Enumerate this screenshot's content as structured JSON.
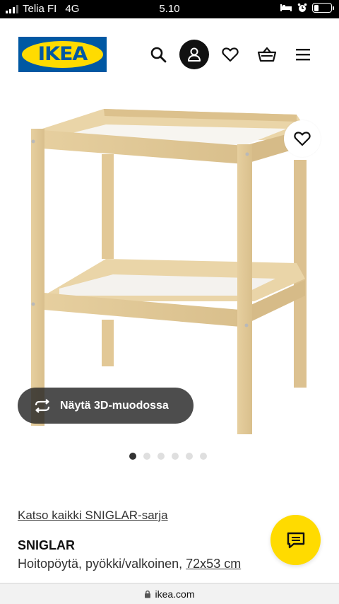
{
  "status_bar": {
    "carrier": "Telia FI",
    "network": "4G",
    "time": "5.10",
    "icons": [
      "signal-icon",
      "bed-icon",
      "alarm-icon",
      "battery-icon"
    ],
    "battery_level": 0.3
  },
  "header": {
    "logo_text": "IKEA",
    "brand_colors": {
      "blue": "#0058a3",
      "yellow": "#ffdb00"
    },
    "icons": [
      "search-icon",
      "account-icon",
      "heart-icon",
      "basket-icon",
      "menu-icon"
    ]
  },
  "gallery": {
    "view_3d_label": "Näytä 3D-muodossa",
    "image_count": 6,
    "active_index": 0
  },
  "product": {
    "series_link": "Katso kaikki SNIGLAR-sarja",
    "name": "SNIGLAR",
    "description": "Hoitopöytä, pyökki/valkoinen,",
    "dimensions": "72x53 cm"
  },
  "url_bar": {
    "domain": "ikea.com"
  }
}
